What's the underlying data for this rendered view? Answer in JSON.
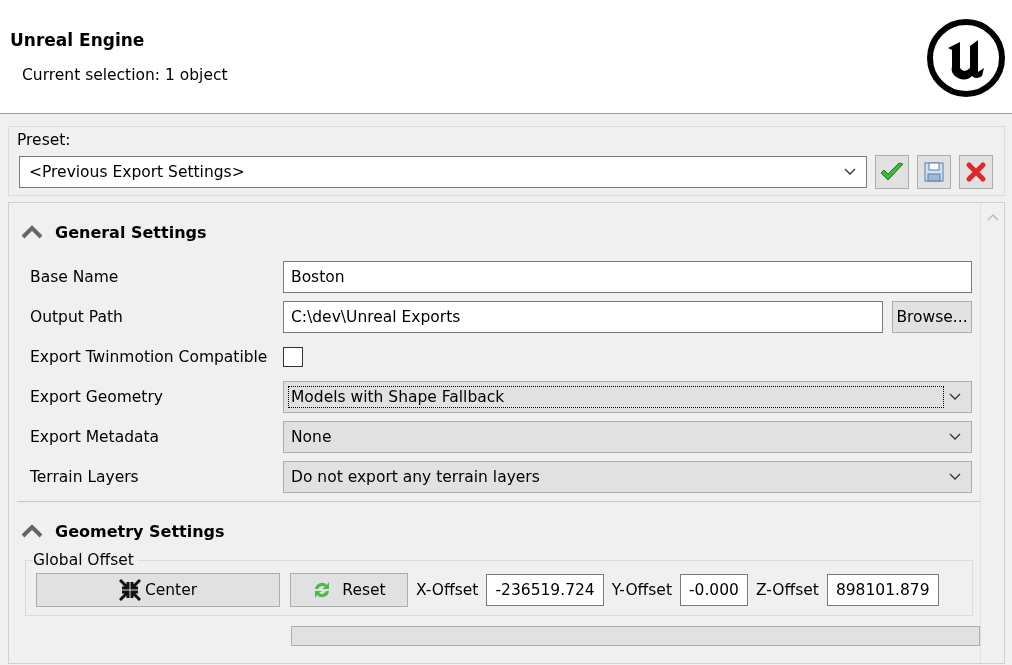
{
  "header": {
    "title": "Unreal Engine",
    "subtitle": "Current selection: 1 object"
  },
  "preset": {
    "label": "Preset:",
    "value": "<Previous Export Settings>"
  },
  "general": {
    "title": "General Settings",
    "expanded": true,
    "fields": [
      {
        "kind": "text",
        "label": "Base Name",
        "value": "Boston"
      },
      {
        "kind": "path",
        "label": "Output Path",
        "value": "C:\\dev\\Unreal Exports",
        "button": "Browse..."
      },
      {
        "kind": "checkbox",
        "label": "Export Twinmotion Compatible",
        "checked": false
      },
      {
        "kind": "dropdown",
        "label": "Export Geometry",
        "value": "Models with Shape Fallback",
        "focused": true
      },
      {
        "kind": "dropdown",
        "label": "Export Metadata",
        "value": "None",
        "focused": false
      },
      {
        "kind": "dropdown",
        "label": "Terrain Layers",
        "value": "Do not export any terrain layers",
        "focused": false
      }
    ]
  },
  "geometry": {
    "title": "Geometry Settings",
    "expanded": true,
    "group": "Global Offset",
    "center": "Center",
    "reset": "Reset",
    "offsets": [
      {
        "label": "X-Offset",
        "value": "-236519.724"
      },
      {
        "label": "Y-Offset",
        "value": "-0.000"
      },
      {
        "label": "Z-Offset",
        "value": "898101.879"
      }
    ]
  }
}
